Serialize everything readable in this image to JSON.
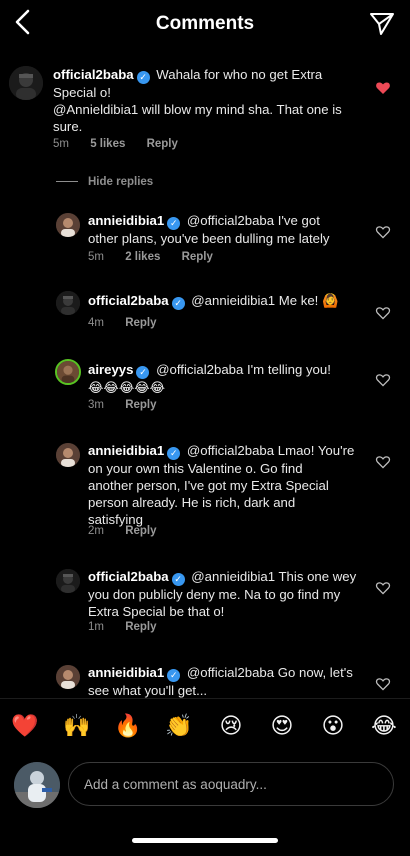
{
  "header": {
    "title": "Comments"
  },
  "main_comment": {
    "user": "official2baba",
    "text_line1": "Wahala for who no get Extra",
    "text_line2": "Special o!",
    "text_line3": "@Annieldibia1 will blow my mind sha. That one is",
    "text_line4": "sure.",
    "time": "5m",
    "likes": "5 likes",
    "reply": "Reply",
    "liked": true
  },
  "hide_replies": "Hide replies",
  "replies": [
    {
      "user": "annieidibia1",
      "lines": [
        "@official2baba I've got",
        "other plans, you've been dulling me lately"
      ],
      "time": "5m",
      "likes": "2 likes",
      "reply": "Reply"
    },
    {
      "user": "official2baba",
      "lines": [
        "@annieidibia1 Me ke! 🙆"
      ],
      "time": "4m",
      "reply": "Reply"
    },
    {
      "user": "aireyys",
      "lines": [
        "@official2baba I'm telling you!",
        "😂😂😂😂😂"
      ],
      "time": "3m",
      "reply": "Reply"
    },
    {
      "user": "annieidibia1",
      "lines": [
        "@official2baba Lmao! You're",
        "on your own this Valentine o. Go find",
        "another person, I've got my Extra Special",
        "person already. He is rich, dark and",
        "satisfying"
      ],
      "time": "2m",
      "reply": "Reply"
    },
    {
      "user": "official2baba",
      "lines": [
        "@annieidibia1 This one wey",
        "you don publicly deny me. Na to go find my",
        "Extra Special be that o!"
      ],
      "time": "1m",
      "reply": "Reply"
    },
    {
      "user": "annieidibia1",
      "lines": [
        "@official2baba Go now, let's",
        "see what you'll get..."
      ]
    }
  ],
  "emoji_bar": [
    "❤️",
    "🙌",
    "🔥",
    "👏",
    "😢",
    "😍",
    "😮",
    "😂"
  ],
  "composer": {
    "placeholder": "Add a comment as aoquadry..."
  },
  "colors": {
    "verified": "#3897f0",
    "liked_heart": "#ed4956",
    "background": "#000000"
  },
  "icons": [
    "back-icon",
    "direct-share-icon",
    "heart-icon",
    "verified-badge-icon"
  ]
}
